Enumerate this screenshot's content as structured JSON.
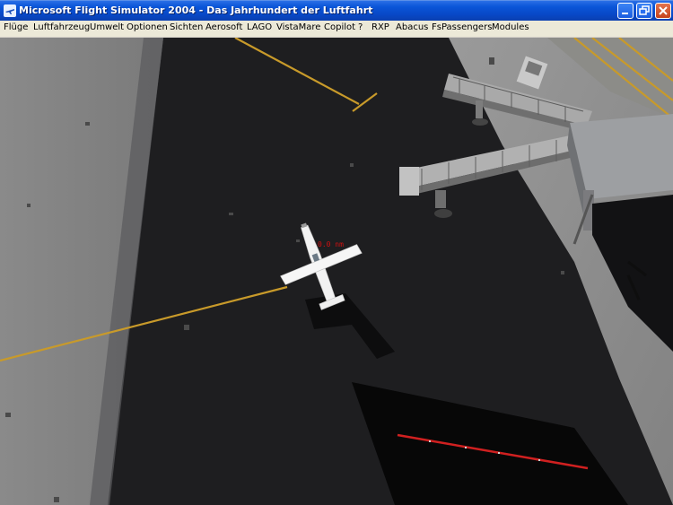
{
  "window": {
    "title": "Microsoft Flight Simulator 2004 - Das Jahrhundert der Luftfahrt",
    "icon": "plane-app-icon"
  },
  "menu": [
    {
      "id": "fluege",
      "label": "Flüge"
    },
    {
      "id": "luftfahrzeug",
      "label": "Luftfahrzeug"
    },
    {
      "id": "umwelt",
      "label": "Umwelt"
    },
    {
      "id": "optionen",
      "label": "Optionen"
    },
    {
      "id": "sichten",
      "label": "Sichten"
    },
    {
      "id": "aerosoft",
      "label": "Aerosoft"
    },
    {
      "id": "lago",
      "label": "LAGO"
    },
    {
      "id": "vistamare",
      "label": "VistaMare"
    },
    {
      "id": "copilot",
      "label": "Copilot"
    },
    {
      "id": "help",
      "label": "?"
    },
    {
      "id": "rxp",
      "label": "RXP"
    },
    {
      "id": "abacus",
      "label": "Abacus"
    },
    {
      "id": "fspassengers",
      "label": "FsPassengers"
    },
    {
      "id": "modules",
      "label": "Modules"
    }
  ],
  "scene": {
    "aircraft_label": "0.0 nm",
    "colors": {
      "concrete": "#8f8f8f",
      "asphalt": "#1d1d1f",
      "taxi_line": "#c89a2a",
      "edge_light": "#d02020"
    }
  }
}
